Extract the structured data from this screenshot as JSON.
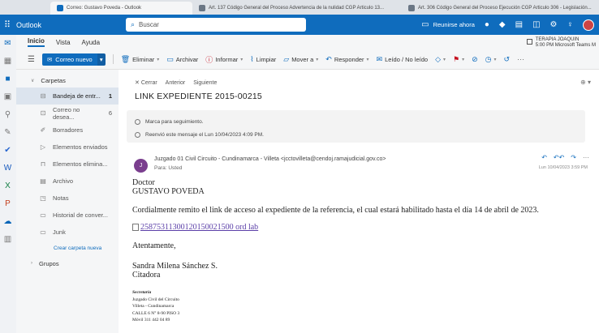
{
  "browser": {
    "tabs": [
      {
        "label": "Correo: Gustavo Poveda - Outlook",
        "active": true
      },
      {
        "label": "Art. 137 Código General del Proceso Advertencia de la nulidad CGP Articulo 13...",
        "active": false
      },
      {
        "label": "Art. 306 Código General del Proceso Ejecución CGP Articulo 306 - Legislación...",
        "active": false
      }
    ]
  },
  "topbar": {
    "app_name": "Outlook",
    "search_placeholder": "Buscar",
    "meet_now": "Reunirse ahora"
  },
  "ribbon_tabs": [
    "Inicio",
    "Vista",
    "Ayuda"
  ],
  "teams_reminder": {
    "title": "TERAPIA JOAQUIN",
    "detail": "5:00 PM Microsoft Teams M"
  },
  "ribbon": {
    "new_mail": "Correo nuevo",
    "delete": "Eliminar",
    "archive": "Archivar",
    "report": "Informar",
    "sweep": "Limpiar",
    "move": "Mover a",
    "reply": "Responder",
    "read_unread": "Leído / No leído"
  },
  "folders": {
    "header": "Carpetas",
    "items": [
      {
        "label": "Bandeja de entr...",
        "count": "1",
        "icon": "inbox-icon",
        "active": true
      },
      {
        "label": "Correo no desea...",
        "count": "6",
        "icon": "junk-mail-icon",
        "active": false
      },
      {
        "label": "Borradores",
        "count": "",
        "icon": "draft-icon",
        "active": false
      },
      {
        "label": "Elementos enviados",
        "count": "",
        "icon": "sent-icon",
        "active": false
      },
      {
        "label": "Elementos elimina...",
        "count": "",
        "icon": "trash-icon",
        "active": false
      },
      {
        "label": "Archivo",
        "count": "",
        "icon": "archive-icon",
        "active": false
      },
      {
        "label": "Notas",
        "count": "",
        "icon": "notes-icon",
        "active": false
      },
      {
        "label": "Historial de conver...",
        "count": "",
        "icon": "folder-icon",
        "active": false
      },
      {
        "label": "Junk",
        "count": "",
        "icon": "folder-icon",
        "active": false
      }
    ],
    "new_folder": "Crear carpeta nueva",
    "groups": "Grupos"
  },
  "message": {
    "close": "Cerrar",
    "previous": "Anterior",
    "next": "Siguiente",
    "subject": "LINK EXPEDIENTE 2015-00215",
    "notices": [
      "Marca para seguimiento.",
      "Reenvió este mensaje el Lun 10/04/2023 4:09 PM."
    ],
    "avatar_initial": "J",
    "sender": "Juzgado 01 Civil Circuito - Cundinamarca - Villeta <jcctovilleta@cendoj.ramajudicial.gov.co>",
    "to": "Para: Usted",
    "date": "Lun 10/04/2023 3:59 PM",
    "body": {
      "salutation_1": "Doctor",
      "salutation_2": "GUSTAVO POVEDA",
      "paragraph": "Cordialmente remito el link de acceso al expediente de la referencia, el cual estará habilitado hasta el día 14 de abril de 2023.",
      "link": "25875311300120150021500 ord lab",
      "greeting": "Atentamente,",
      "signer": "Sandra Milena Sánchez S.",
      "signer_role": "Citadora",
      "sig_title": "Secretaria",
      "sig_lines": [
        "Juzgado Civil del Circuito",
        "Villeta - Cundinamarca",
        "CALLE 6 N° 8-90 PISO 3",
        "Móvil 311 442 04 89"
      ]
    }
  },
  "colors": {
    "accent": "#0f6cbd",
    "selected_folder": "#dce4ee",
    "link": "#5b3fa8"
  }
}
